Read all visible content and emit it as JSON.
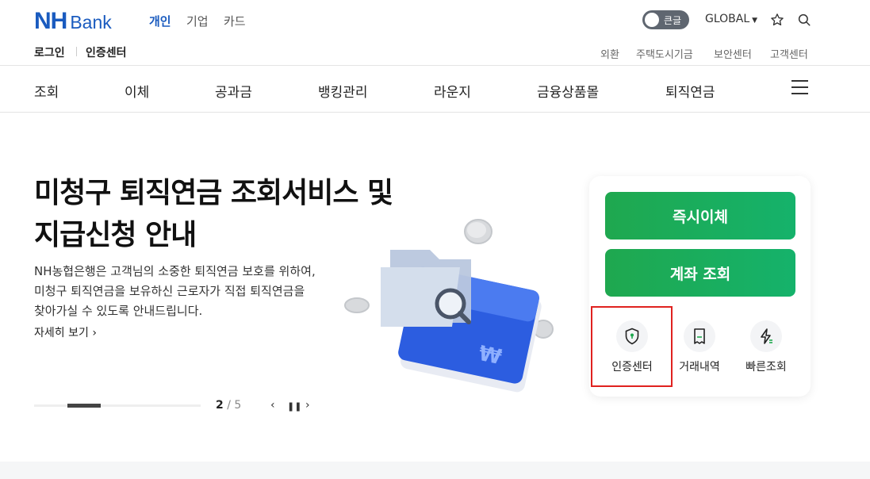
{
  "brand": {
    "logo_mark": "NH",
    "logo_word": "Bank"
  },
  "header": {
    "segments": [
      {
        "label": "개인",
        "active": true
      },
      {
        "label": "기업",
        "active": false
      },
      {
        "label": "카드",
        "active": false
      }
    ],
    "large_text_toggle": "큰글",
    "global_label": "GLOBAL"
  },
  "subheader": {
    "login": "로그인",
    "cert_center": "인증센터",
    "links": [
      "외환",
      "주택도시기금",
      "보안센터",
      "고객센터"
    ]
  },
  "gnb": [
    "조회",
    "이체",
    "공과금",
    "뱅킹관리",
    "라운지",
    "금융상품몰",
    "퇴직연금"
  ],
  "hero": {
    "title_line1": "미청구 퇴직연금 조회서비스 및",
    "title_line2": "지급신청 안내",
    "desc_line1": "NH농협은행은 고객님의 소중한 퇴직연금 보호를 위하여,",
    "desc_line2": "미청구 퇴직연금을 보유하신 근로자가 직접 퇴직연금을",
    "desc_line3": "찾아가실 수 있도록 안내드립니다.",
    "more_label": "자세히 보기",
    "slide_current": "2",
    "slide_total": "5",
    "progress": 0.2
  },
  "panel": {
    "instant_transfer": "즉시이체",
    "account_inquiry": "계좌 조회",
    "quick_menu": [
      {
        "label": "인증센터",
        "icon": "shield-icon"
      },
      {
        "label": "거래내역",
        "icon": "receipt-icon"
      },
      {
        "label": "빠른조회",
        "icon": "lightning-icon"
      }
    ]
  },
  "colors": {
    "brand_blue": "#1a5bbf",
    "green": "#1fa84f",
    "highlight_red": "#e0221f"
  }
}
